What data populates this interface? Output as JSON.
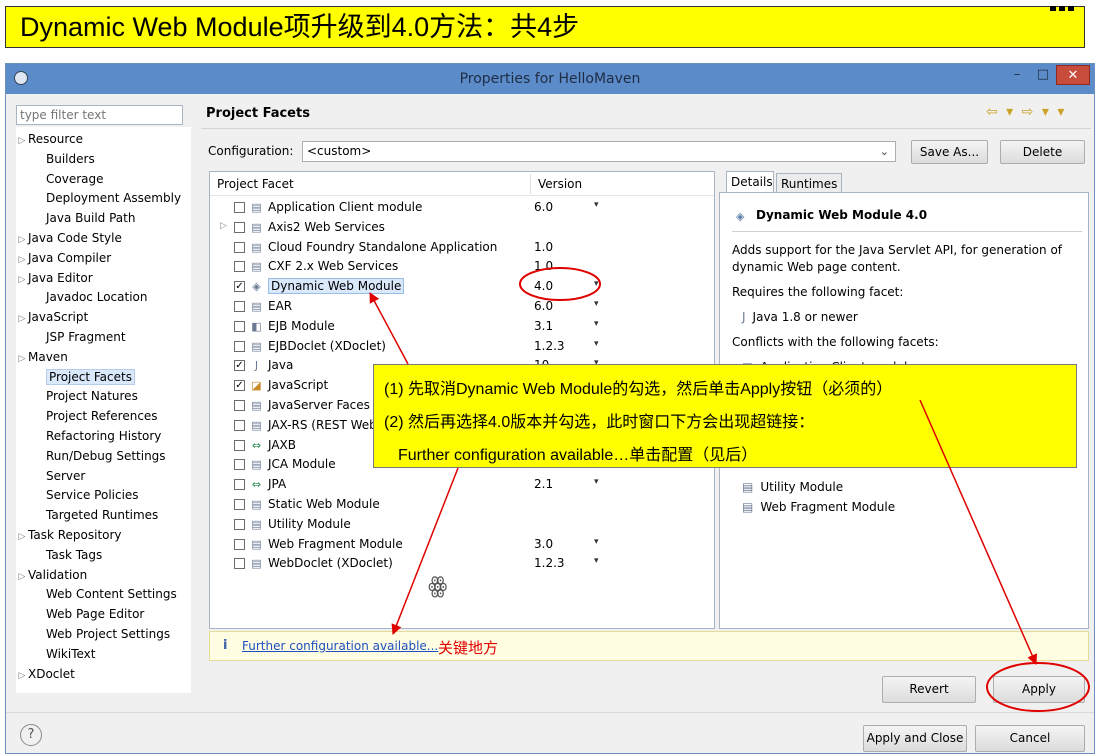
{
  "banner": {
    "text": "Dynamic Web Module项升级到4.0方法：共4步"
  },
  "window": {
    "title": "Properties for HelloMaven",
    "controls": {
      "minimize": "–",
      "maximize": "□",
      "close": "✕"
    }
  },
  "filter": {
    "placeholder": "type filter text"
  },
  "nav": {
    "items": [
      {
        "label": "Resource",
        "expandable": true
      },
      {
        "label": "Builders",
        "expandable": false
      },
      {
        "label": "Coverage",
        "expandable": false
      },
      {
        "label": "Deployment Assembly",
        "expandable": false
      },
      {
        "label": "Java Build Path",
        "expandable": false
      },
      {
        "label": "Java Code Style",
        "expandable": true
      },
      {
        "label": "Java Compiler",
        "expandable": true
      },
      {
        "label": "Java Editor",
        "expandable": true
      },
      {
        "label": "Javadoc Location",
        "expandable": false
      },
      {
        "label": "JavaScript",
        "expandable": true
      },
      {
        "label": "JSP Fragment",
        "expandable": false
      },
      {
        "label": "Maven",
        "expandable": true
      },
      {
        "label": "Project Facets",
        "expandable": false,
        "selected": true
      },
      {
        "label": "Project Natures",
        "expandable": false
      },
      {
        "label": "Project References",
        "expandable": false
      },
      {
        "label": "Refactoring History",
        "expandable": false
      },
      {
        "label": "Run/Debug Settings",
        "expandable": false
      },
      {
        "label": "Server",
        "expandable": false
      },
      {
        "label": "Service Policies",
        "expandable": false
      },
      {
        "label": "Targeted Runtimes",
        "expandable": false
      },
      {
        "label": "Task Repository",
        "expandable": true
      },
      {
        "label": "Task Tags",
        "expandable": false
      },
      {
        "label": "Validation",
        "expandable": true
      },
      {
        "label": "Web Content Settings",
        "expandable": false
      },
      {
        "label": "Web Page Editor",
        "expandable": false
      },
      {
        "label": "Web Project Settings",
        "expandable": false
      },
      {
        "label": "WikiText",
        "expandable": false
      },
      {
        "label": "XDoclet",
        "expandable": true
      }
    ]
  },
  "header": {
    "title": "Project Facets",
    "nav_icons": "⇦ ▾ ⇨ ▾ ▾"
  },
  "config": {
    "label": "Configuration:",
    "value": "<custom>",
    "save_as_label": "Save As...",
    "delete_label": "Delete"
  },
  "facets": {
    "col_facet": "Project Facet",
    "col_version": "Version",
    "rows": [
      {
        "name": "Application Client module",
        "version": "6.0",
        "dropdown": true,
        "checked": false,
        "expandable": false,
        "icon": "page-icon"
      },
      {
        "name": "Axis2 Web Services",
        "version": "",
        "dropdown": false,
        "checked": false,
        "expandable": true,
        "icon": "page-icon"
      },
      {
        "name": "Cloud Foundry Standalone Application",
        "version": "1.0",
        "dropdown": false,
        "checked": false,
        "expandable": false,
        "icon": "page-icon"
      },
      {
        "name": "CXF 2.x Web Services",
        "version": "1.0",
        "dropdown": false,
        "checked": false,
        "expandable": false,
        "icon": "page-icon"
      },
      {
        "name": "Dynamic Web Module",
        "version": "4.0",
        "dropdown": true,
        "checked": true,
        "expandable": false,
        "icon": "web-module-icon",
        "selected": true
      },
      {
        "name": "EAR",
        "version": "6.0",
        "dropdown": true,
        "checked": false,
        "expandable": false,
        "icon": "page-icon"
      },
      {
        "name": "EJB Module",
        "version": "3.1",
        "dropdown": true,
        "checked": false,
        "expandable": false,
        "icon": "ejb-icon"
      },
      {
        "name": "EJBDoclet (XDoclet)",
        "version": "1.2.3",
        "dropdown": true,
        "checked": false,
        "expandable": false,
        "icon": "page-icon"
      },
      {
        "name": "Java",
        "version": "10",
        "dropdown": true,
        "checked": true,
        "expandable": false,
        "icon": "java-icon"
      },
      {
        "name": "JavaScript",
        "version": "",
        "dropdown": false,
        "checked": true,
        "expandable": false,
        "icon": "javascript-icon"
      },
      {
        "name": "JavaServer Faces",
        "version": "",
        "dropdown": false,
        "checked": false,
        "expandable": false,
        "icon": "page-icon"
      },
      {
        "name": "JAX-RS (REST Web",
        "version": "",
        "dropdown": false,
        "checked": false,
        "expandable": false,
        "icon": "page-icon"
      },
      {
        "name": "JAXB",
        "version": "",
        "dropdown": false,
        "checked": false,
        "expandable": false,
        "icon": "jaxb-icon"
      },
      {
        "name": "JCA Module",
        "version": "",
        "dropdown": false,
        "checked": false,
        "expandable": false,
        "icon": "page-icon"
      },
      {
        "name": "JPA",
        "version": "2.1",
        "dropdown": true,
        "checked": false,
        "expandable": false,
        "icon": "jpa-icon"
      },
      {
        "name": "Static Web Module",
        "version": "",
        "dropdown": false,
        "checked": false,
        "expandable": false,
        "icon": "page-icon"
      },
      {
        "name": "Utility Module",
        "version": "",
        "dropdown": false,
        "checked": false,
        "expandable": false,
        "icon": "page-icon"
      },
      {
        "name": "Web Fragment Module",
        "version": "3.0",
        "dropdown": true,
        "checked": false,
        "expandable": false,
        "icon": "page-icon"
      },
      {
        "name": "WebDoclet (XDoclet)",
        "version": "1.2.3",
        "dropdown": true,
        "checked": false,
        "expandable": false,
        "icon": "page-icon"
      }
    ]
  },
  "details": {
    "tab_details": "Details",
    "tab_runtimes": "Runtimes",
    "title": "Dynamic Web Module 4.0",
    "description_1": "Adds support for the Java Servlet API, for generation of",
    "description_2": "dynamic Web page content.",
    "requires_label": "Requires the following facet:",
    "requires_item": "Java 1.8 or newer",
    "conflicts_label": "Conflicts with the following facets:",
    "conflicts": [
      "Application Client module",
      "Utility Module",
      "Web Fragment Module"
    ]
  },
  "info": {
    "link": "Further configuration available...",
    "note": "关键地方"
  },
  "buttons": {
    "revert": "Revert",
    "apply": "Apply",
    "apply_close": "Apply and Close",
    "cancel": "Cancel",
    "help": "?"
  },
  "callout": {
    "line1": "(1) 先取消Dynamic Web Module的勾选，然后单击Apply按钮（必须的）",
    "line2": "(2) 然后再选择4.0版本并勾选，此时窗口下方会出现超链接：",
    "line3": "Further configuration available…单击配置（见后）"
  },
  "colors": {
    "banner": "#ffff00",
    "titlebar": "#5b8bc8",
    "annotation": "#e00000",
    "link": "#1f4fc2"
  }
}
